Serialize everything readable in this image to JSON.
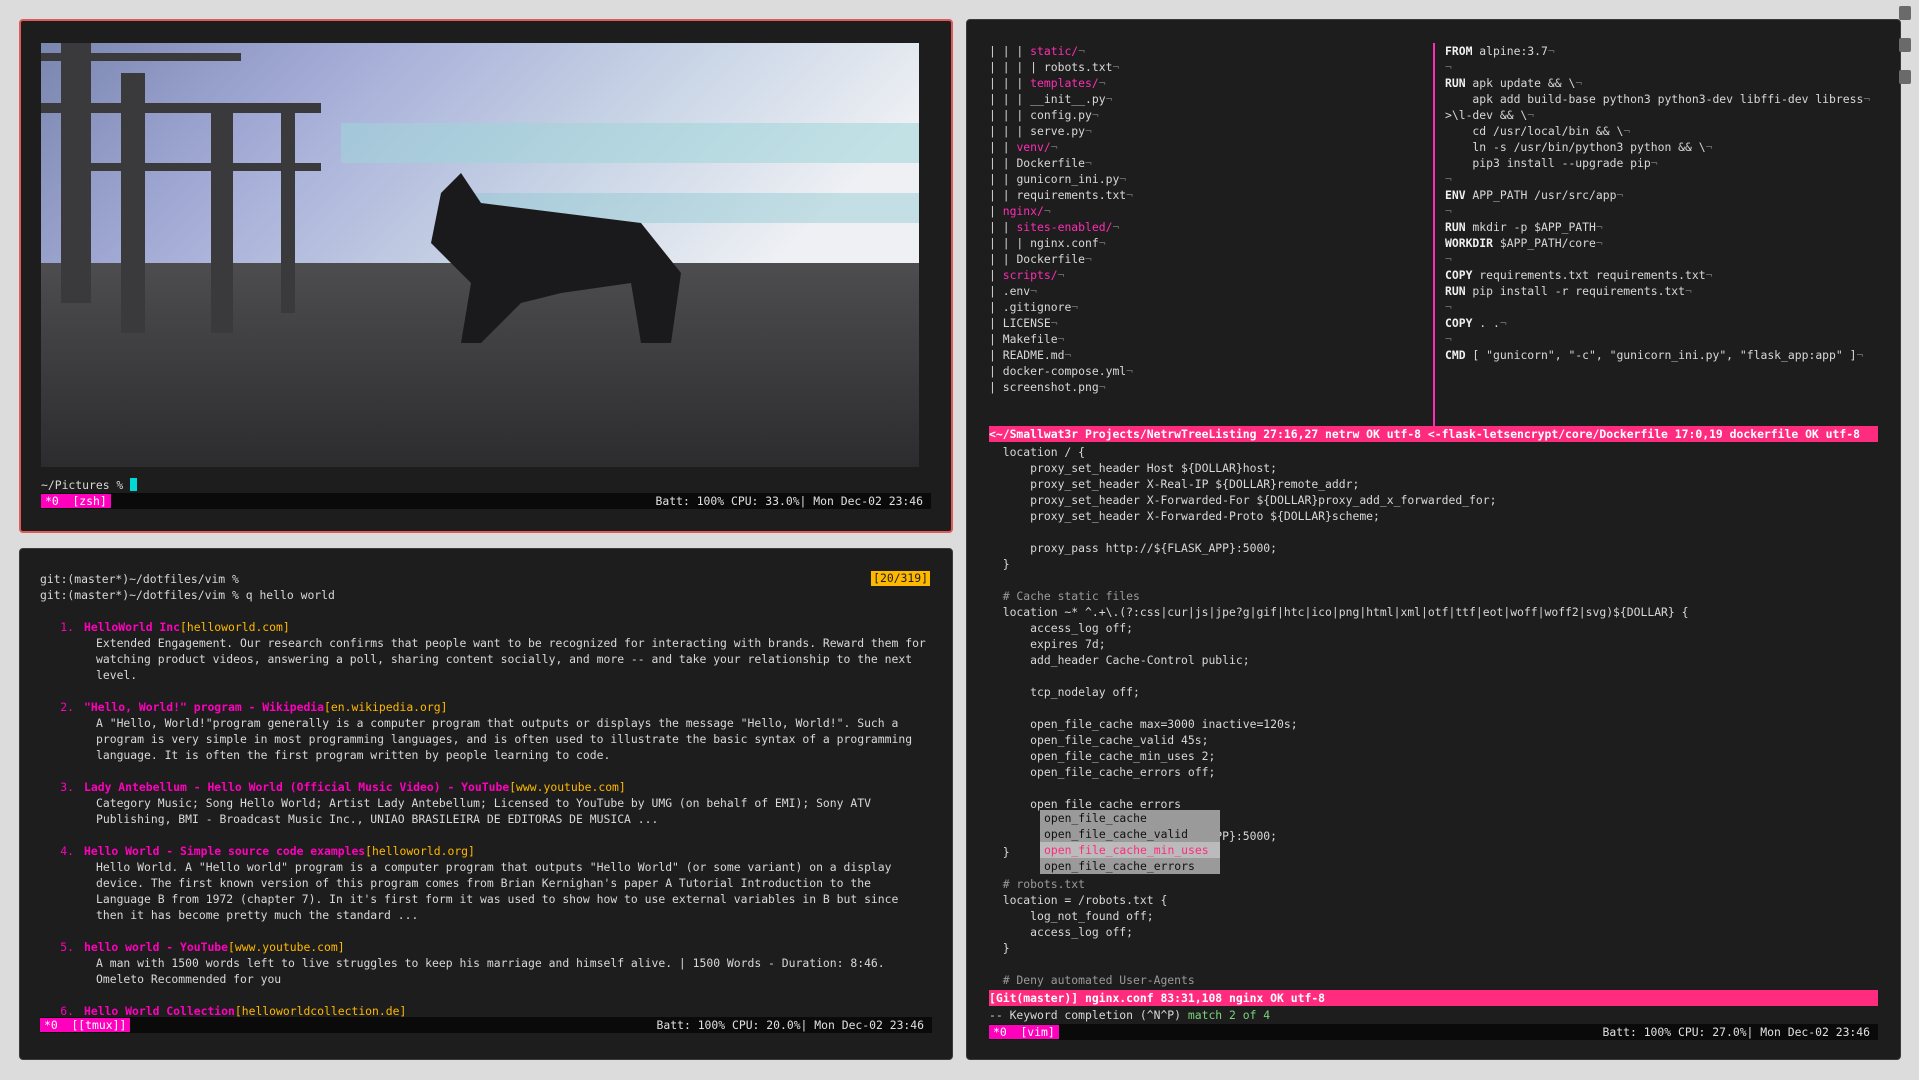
{
  "image_window": {
    "prompt": "~/Pictures %",
    "status": {
      "index": "*0",
      "name": "[zsh]",
      "info": "Batt: 100% CPU: 33.0%| Mon Dec-02 23:46"
    }
  },
  "search_window": {
    "prompt_lines": [
      "git:(master*)~/dotfiles/vim %",
      "git:(master*)~/dotfiles/vim % q hello world"
    ],
    "counter": "[20/319]",
    "results": [
      {
        "num": "1.",
        "title": "HelloWorld Inc",
        "url": "[helloworld.com]",
        "body": "Extended Engagement. Our research confirms that people want to be recognized for interacting with brands. Reward them for watching product videos, answering a poll, sharing content socially, and more -- and take your relationship to the next level."
      },
      {
        "num": "2.",
        "title": "\"Hello, World!\" program - Wikipedia",
        "url": "[en.wikipedia.org]",
        "body": "A \"Hello, World!\"program generally is a computer program that outputs or displays the message \"Hello, World!\". Such a program is very simple in most programming languages, and is often used to illustrate the basic syntax of a programming language. It is often the first program written by people learning to code."
      },
      {
        "num": "3.",
        "title": "Lady Antebellum - Hello World (Official Music Video) - YouTube",
        "url": "[www.youtube.com]",
        "body": "Category Music; Song Hello World; Artist Lady Antebellum; Licensed to YouTube by UMG (on behalf of EMI); Sony ATV Publishing, BMI - Broadcast Music Inc., UNIAO BRASILEIRA DE EDITORAS DE MUSICA ..."
      },
      {
        "num": "4.",
        "title": "Hello World - Simple source code examples",
        "url": "[helloworld.org]",
        "body": "Hello World. A \"Hello world\" program is a computer program that outputs \"Hello World\" (or some variant) on a display device. The first known version of this program comes from Brian Kernighan's paper A Tutorial Introduction to the Language B from 1972 (chapter 7). In it's first form it was used to show how to use external variables in B but since then it has become pretty much the standard ..."
      },
      {
        "num": "5.",
        "title": "hello world - YouTube",
        "url": "[www.youtube.com]",
        "body": "A man with 1500 words left to live struggles to keep his marriage and himself alive. | 1500 Words - Duration: 8:46. Omeleto Recommended for you"
      },
      {
        "num": "6.",
        "title": "Hello World Collection",
        "url": "[helloworldcollection.de]",
        "body": ""
      }
    ],
    "status": {
      "index": "*0",
      "name": "[[tmux]]",
      "info": "Batt: 100% CPU: 20.0%| Mon Dec-02 23:46"
    }
  },
  "vim_window": {
    "tree": [
      {
        "prefix": "| | | ",
        "name": "static/",
        "dir": true
      },
      {
        "prefix": "| | | | ",
        "name": "robots.txt",
        "dir": false
      },
      {
        "prefix": "| | | ",
        "name": "templates/",
        "dir": true
      },
      {
        "prefix": "| | | ",
        "name": "__init__.py",
        "dir": false
      },
      {
        "prefix": "| | | ",
        "name": "config.py",
        "dir": false
      },
      {
        "prefix": "| | | ",
        "name": "serve.py",
        "dir": false
      },
      {
        "prefix": "| | ",
        "name": "venv/",
        "dir": true
      },
      {
        "prefix": "| | ",
        "name": "Dockerfile",
        "dir": false
      },
      {
        "prefix": "| | ",
        "name": "gunicorn_ini.py",
        "dir": false
      },
      {
        "prefix": "| | ",
        "name": "requirements.txt",
        "dir": false
      },
      {
        "prefix": "| ",
        "name": "nginx/",
        "dir": true
      },
      {
        "prefix": "| | ",
        "name": "sites-enabled/",
        "dir": true
      },
      {
        "prefix": "| | | ",
        "name": "nginx.conf",
        "dir": false
      },
      {
        "prefix": "| | ",
        "name": "Dockerfile",
        "dir": false
      },
      {
        "prefix": "| ",
        "name": "scripts/",
        "dir": true
      },
      {
        "prefix": "| ",
        "name": ".env",
        "dir": false
      },
      {
        "prefix": "| ",
        "name": ".gitignore",
        "dir": false
      },
      {
        "prefix": "| ",
        "name": "LICENSE",
        "dir": false
      },
      {
        "prefix": "| ",
        "name": "Makefile",
        "dir": false
      },
      {
        "prefix": "| ",
        "name": "README.md",
        "dir": false
      },
      {
        "prefix": "| ",
        "name": "docker-compose.yml",
        "dir": false
      },
      {
        "prefix": "| ",
        "name": "screenshot.png",
        "dir": false
      }
    ],
    "dockerfile": [
      {
        "kw": "FROM",
        "rest": " alpine:3.7"
      },
      {
        "kw": "",
        "rest": ""
      },
      {
        "kw": "RUN",
        "rest": " apk update && \\"
      },
      {
        "kw": "",
        "rest": "    apk add build-base python3 python3-dev libffi-dev libress"
      },
      {
        "kw": "",
        "rest": ">\\l-dev && \\"
      },
      {
        "kw": "",
        "rest": "    cd /usr/local/bin && \\"
      },
      {
        "kw": "",
        "rest": "    ln -s /usr/bin/python3 python && \\"
      },
      {
        "kw": "",
        "rest": "    pip3 install --upgrade pip"
      },
      {
        "kw": "",
        "rest": ""
      },
      {
        "kw": "ENV",
        "rest": " APP_PATH /usr/src/app"
      },
      {
        "kw": "",
        "rest": ""
      },
      {
        "kw": "RUN",
        "rest": " mkdir -p $APP_PATH"
      },
      {
        "kw": "WORKDIR",
        "rest": " $APP_PATH/core"
      },
      {
        "kw": "",
        "rest": ""
      },
      {
        "kw": "COPY",
        "rest": " requirements.txt requirements.txt"
      },
      {
        "kw": "RUN",
        "rest": " pip install -r requirements.txt"
      },
      {
        "kw": "",
        "rest": ""
      },
      {
        "kw": "COPY",
        "rest": " . ."
      },
      {
        "kw": "",
        "rest": ""
      },
      {
        "kw": "CMD",
        "rest": " [ \"gunicorn\", \"-c\", \"gunicorn_ini.py\", \"flask_app:app\" ]"
      }
    ],
    "split_status": "<~/Smallwat3r Projects/NetrwTreeListing 27:16,27 netrw OK utf-8 <-flask-letsencrypt/core/Dockerfile 17:0,19 dockerfile OK utf-8",
    "nginx": [
      "  location / {",
      "      proxy_set_header Host ${DOLLAR}host;",
      "      proxy_set_header X-Real-IP ${DOLLAR}remote_addr;",
      "      proxy_set_header X-Forwarded-For ${DOLLAR}proxy_add_x_forwarded_for;",
      "      proxy_set_header X-Forwarded-Proto ${DOLLAR}scheme;",
      "",
      "      proxy_pass http://${FLASK_APP}:5000;",
      "  }",
      "",
      "  # Cache static files",
      "  location ~* ^.+\\.(?:css|cur|js|jpe?g|gif|htc|ico|png|html|xml|otf|ttf|eot|woff|woff2|svg)${DOLLAR} {",
      "      access_log off;",
      "      expires 7d;",
      "      add_header Cache-Control public;",
      "",
      "      tcp_nodelay off;",
      "",
      "      open_file_cache max=3000 inactive=120s;",
      "      open_file_cache_valid 45s;",
      "      open_file_cache_min_uses 2;",
      "      open_file_cache_errors off;",
      "",
      "      open_file_cache_errors",
      "",
      "                               _APP}:5000;",
      "  }",
      "",
      "  # robots.txt",
      "  location = /robots.txt {",
      "      log_not_found off;",
      "      access_log off;",
      "  }",
      "",
      "  # Deny automated User-Agents"
    ],
    "completion": [
      "open_file_cache",
      "open_file_cache_valid",
      "open_file_cache_min_uses",
      "open_file_cache_errors"
    ],
    "bottom_status": "[Git(master)] nginx.conf 83:31,108 nginx OK utf-8",
    "message": {
      "text": "-- Keyword completion (^N^P) ",
      "match": "match 2 of 4"
    },
    "status": {
      "index": "*0",
      "name": "[vim]",
      "info": "Batt: 100% CPU: 27.0%| Mon Dec-02 23:46"
    }
  },
  "colors": {
    "accent": "#ff00bd",
    "url": "#ffb800",
    "status_bar": "#ff2b7f",
    "cursor": "#00d8d8"
  }
}
